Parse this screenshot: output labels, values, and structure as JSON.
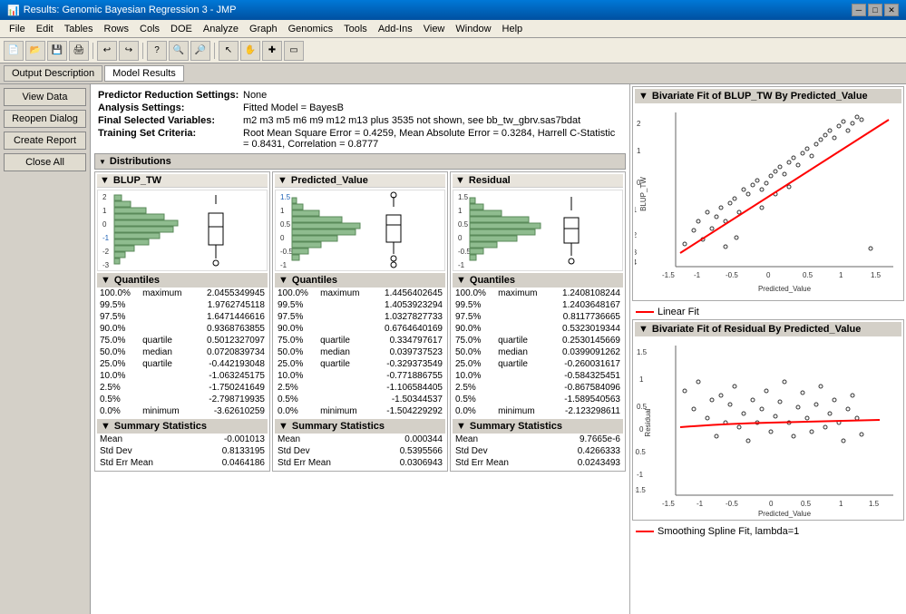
{
  "window": {
    "title": "Results: Genomic Bayesian Regression 3 - JMP"
  },
  "menu": {
    "items": [
      "File",
      "Edit",
      "Tables",
      "Rows",
      "Cols",
      "DOE",
      "Analyze",
      "Graph",
      "Genomics",
      "Tools",
      "Add-Ins",
      "View",
      "Window",
      "Help"
    ]
  },
  "tabs": {
    "output_label": "Output Description",
    "model_label": "Model Results",
    "active": "Model Results"
  },
  "sidebar": {
    "buttons": [
      "View Data",
      "Reopen Dialog",
      "Create Report",
      "Close All"
    ]
  },
  "info": {
    "predictor_label": "Predictor Reduction Settings:",
    "predictor_value": "None",
    "analysis_label": "Analysis Settings:",
    "analysis_value": "Fitted Model = BayesB",
    "variables_label": "Final Selected Variables:",
    "variables_value": "m2 m3 m5 m6 m9 m12 m13 plus 3535 not shown, see bb_tw_gbrv.sas7bdat",
    "training_label": "Training Set Criteria:",
    "training_value": "Root Mean Square Error = 0.4259, Mean Absolute Error = 0.3284, Harrell C-Statistic = 0.8431, Correlation = 0.8777"
  },
  "distributions": {
    "header": "Distributions",
    "panels": [
      {
        "name": "BLUP_TW",
        "quantiles_header": "Quantiles",
        "quantiles": [
          {
            "pct": "100.0%",
            "label": "maximum",
            "value": "2.0455349945"
          },
          {
            "pct": "99.5%",
            "label": "",
            "value": "1.9762745118"
          },
          {
            "pct": "97.5%",
            "label": "",
            "value": "1.6471446616"
          },
          {
            "pct": "90.0%",
            "label": "",
            "value": "0.9368763855"
          },
          {
            "pct": "75.0%",
            "label": "quartile",
            "value": "0.5012327097"
          },
          {
            "pct": "50.0%",
            "label": "median",
            "value": "0.0720839734"
          },
          {
            "pct": "25.0%",
            "label": "quartile",
            "value": "-0.442193048"
          },
          {
            "pct": "10.0%",
            "label": "",
            "value": "-1.063245175"
          },
          {
            "pct": "2.5%",
            "label": "",
            "value": "-1.750241649"
          },
          {
            "pct": "0.5%",
            "label": "",
            "value": "-2.798719935"
          },
          {
            "pct": "0.0%",
            "label": "minimum",
            "value": "-3.62610259"
          }
        ],
        "summary_header": "Summary Statistics",
        "summary": [
          {
            "label": "Mean",
            "value": "-0.001013"
          },
          {
            "label": "Std Dev",
            "value": "0.8133195"
          },
          {
            "label": "Std Err Mean",
            "value": "0.0464186"
          }
        ],
        "hist_bars": [
          5,
          10,
          20,
          35,
          55,
          75,
          80,
          65,
          45,
          28,
          15,
          8,
          4
        ]
      },
      {
        "name": "Predicted_Value",
        "quantiles_header": "Quantiles",
        "quantiles": [
          {
            "pct": "100.0%",
            "label": "maximum",
            "value": "1.4456402645"
          },
          {
            "pct": "99.5%",
            "label": "",
            "value": "1.4053923294"
          },
          {
            "pct": "97.5%",
            "label": "",
            "value": "1.0327827733"
          },
          {
            "pct": "90.0%",
            "label": "",
            "value": "0.6764640169"
          },
          {
            "pct": "75.0%",
            "label": "quartile",
            "value": "0.334797617"
          },
          {
            "pct": "50.0%",
            "label": "median",
            "value": "0.039737523"
          },
          {
            "pct": "25.0%",
            "label": "quartile",
            "value": "-0.329373549"
          },
          {
            "pct": "10.0%",
            "label": "",
            "value": "-0.771886755"
          },
          {
            "pct": "2.5%",
            "label": "",
            "value": "-1.106584405"
          },
          {
            "pct": "0.5%",
            "label": "",
            "value": "-1.50344537"
          },
          {
            "pct": "0.0%",
            "label": "minimum",
            "value": "-1.504229292"
          }
        ],
        "summary_header": "Summary Statistics",
        "summary": [
          {
            "label": "Mean",
            "value": "0.000344"
          },
          {
            "label": "Std Dev",
            "value": "0.5395566"
          },
          {
            "label": "Std Err Mean",
            "value": "0.0306943"
          }
        ],
        "hist_bars": [
          3,
          8,
          18,
          38,
          65,
          80,
          72,
          50,
          30,
          15,
          7,
          3
        ]
      },
      {
        "name": "Residual",
        "quantiles_header": "Quantiles",
        "quantiles": [
          {
            "pct": "100.0%",
            "label": "maximum",
            "value": "1.2408108244"
          },
          {
            "pct": "99.5%",
            "label": "",
            "value": "1.2403648167"
          },
          {
            "pct": "97.5%",
            "label": "",
            "value": "0.8117736665"
          },
          {
            "pct": "90.0%",
            "label": "",
            "value": "0.5323019344"
          },
          {
            "pct": "75.0%",
            "label": "quartile",
            "value": "0.2530145669"
          },
          {
            "pct": "50.0%",
            "label": "median",
            "value": "0.0399091262"
          },
          {
            "pct": "25.0%",
            "label": "quartile",
            "value": "-0.260031617"
          },
          {
            "pct": "10.0%",
            "label": "",
            "value": "-0.584325451"
          },
          {
            "pct": "2.5%",
            "label": "",
            "value": "-0.867584096"
          },
          {
            "pct": "0.5%",
            "label": "",
            "value": "-1.589540563"
          },
          {
            "pct": "0.0%",
            "label": "minimum",
            "value": "-2.123298611"
          }
        ],
        "summary_header": "Summary Statistics",
        "summary": [
          {
            "label": "Mean",
            "value": "9.7665e-6"
          },
          {
            "label": "Std Dev",
            "value": "0.4266333"
          },
          {
            "label": "Std Err Mean",
            "value": "0.0243493"
          }
        ],
        "hist_bars": [
          4,
          10,
          25,
          50,
          80,
          78,
          55,
          32,
          15,
          7,
          3
        ]
      }
    ]
  },
  "bivariate": {
    "plot1": {
      "title": "Bivariate Fit of BLUP_TW By Predicted_Value",
      "x_label": "Predicted_Value",
      "y_label": "BLUP_TW",
      "x_axis": [
        "-1.5",
        "-1",
        "-0.5",
        "0",
        "0.5",
        "1",
        "1.5"
      ],
      "y_axis": [
        "2",
        "1",
        "0",
        "-1",
        "-2",
        "-3",
        "-4"
      ]
    },
    "fit_label": "Linear Fit",
    "plot2": {
      "title": "Bivariate Fit of Residual By Predicted_Value",
      "x_label": "Predicted_Value",
      "y_label": "Residual",
      "x_axis": [
        "-1.5",
        "-1",
        "-0.5",
        "0",
        "0.5",
        "1",
        "1.5"
      ],
      "y_axis": [
        "1.5",
        "1",
        "0.5",
        "0",
        "-0.5",
        "-1",
        "-1.5"
      ]
    },
    "spline_label": "Smoothing Spline Fit, lambda=1"
  }
}
